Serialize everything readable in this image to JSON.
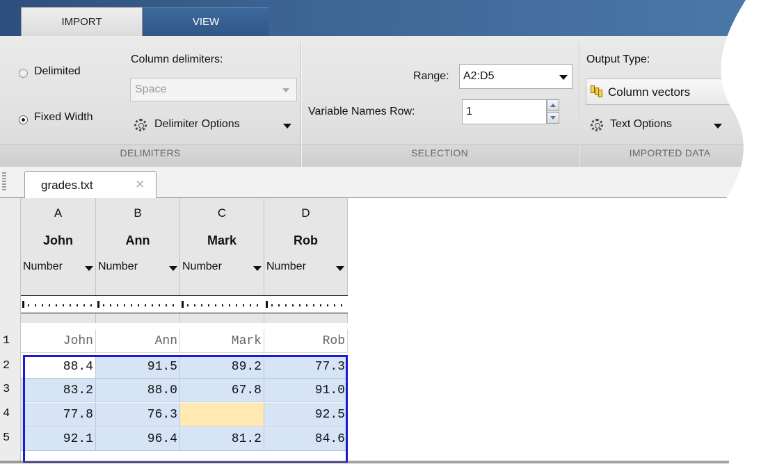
{
  "ribbon_tabs": {
    "import": "IMPORT",
    "view": "VIEW"
  },
  "delimiters": {
    "radio_delimited": "Delimited",
    "radio_fixed_width": "Fixed Width",
    "selected": "Fixed Width",
    "column_delimiters_label": "Column delimiters:",
    "column_delimiters_value": "Space",
    "delimiter_options_label": "Delimiter Options",
    "section_label": "DELIMITERS"
  },
  "selection": {
    "range_label": "Range:",
    "range_value": "A2:D5",
    "var_names_row_label": "Variable Names Row:",
    "var_names_row_value": "1",
    "section_label": "SELECTION"
  },
  "imported_data": {
    "output_type_label": "Output Type:",
    "output_type_value": "Column vectors",
    "text_options_label": "Text Options",
    "section_label": "IMPORTED DATA"
  },
  "document_tab": {
    "label": "grades.txt",
    "close_glyph": "✕"
  },
  "sheet": {
    "columns": [
      {
        "letter": "A",
        "name": "John",
        "type": "Number"
      },
      {
        "letter": "B",
        "name": "Ann",
        "type": "Number"
      },
      {
        "letter": "C",
        "name": "Mark",
        "type": "Number"
      },
      {
        "letter": "D",
        "name": "Rob",
        "type": "Number"
      }
    ],
    "row_numbers": [
      "1",
      "2",
      "3",
      "4",
      "5"
    ],
    "header_row": [
      "John",
      "Ann",
      "Mark",
      "Rob"
    ],
    "rows": [
      [
        "88.4",
        "91.5",
        "89.2",
        "77.3"
      ],
      [
        "83.2",
        "88.0",
        "67.8",
        "91.0"
      ],
      [
        "77.8",
        "76.3",
        "",
        "92.5"
      ],
      [
        "92.1",
        "96.4",
        "81.2",
        "84.6"
      ]
    ]
  },
  "colors": {
    "selection_border": "#1a1ad6",
    "selection_fill": "#d6e4f5",
    "missing_fill": "#ffe9b0",
    "tab_blue": "#2f5686"
  }
}
